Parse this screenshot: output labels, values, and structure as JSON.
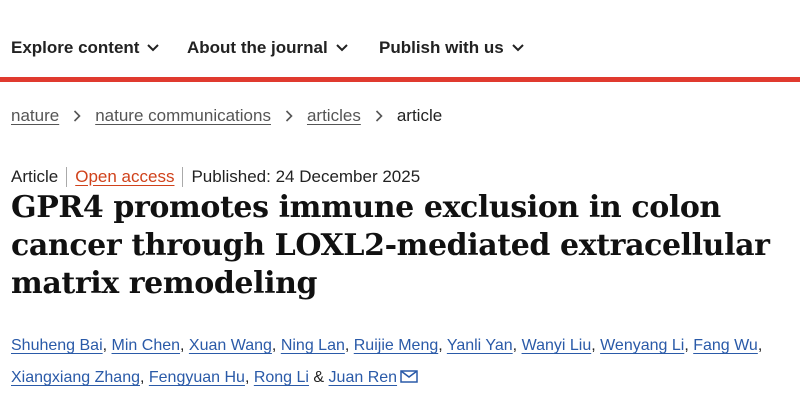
{
  "nav": {
    "items": [
      {
        "label": "Explore content"
      },
      {
        "label": "About the journal"
      },
      {
        "label": "Publish with us"
      }
    ],
    "accent_color": "#e03a2f"
  },
  "breadcrumb": {
    "items": [
      "nature",
      "nature communications",
      "articles"
    ],
    "current": "article"
  },
  "meta": {
    "type": "Article",
    "access": "Open access",
    "published": "Published: 24 December 2025"
  },
  "article": {
    "title": "GPR4 promotes immune exclusion in colon cancer through LOXL2-mediated extracellular matrix remodeling"
  },
  "authors": {
    "list": [
      "Shuheng Bai",
      "Min Chen",
      "Xuan Wang",
      "Ning Lan",
      "Ruijie Meng",
      "Yanli Yan",
      "Wanyi Liu",
      "Wenyang Li",
      "Fang Wu",
      "Xiangxiang Zhang",
      "Fengyuan Hu",
      "Rong Li",
      "Juan Ren"
    ],
    "separator": ", ",
    "final_separator": " & ",
    "contact_icon": "envelope-icon"
  },
  "colors": {
    "link": "#2a5aa8",
    "open_access": "#d0421b"
  }
}
